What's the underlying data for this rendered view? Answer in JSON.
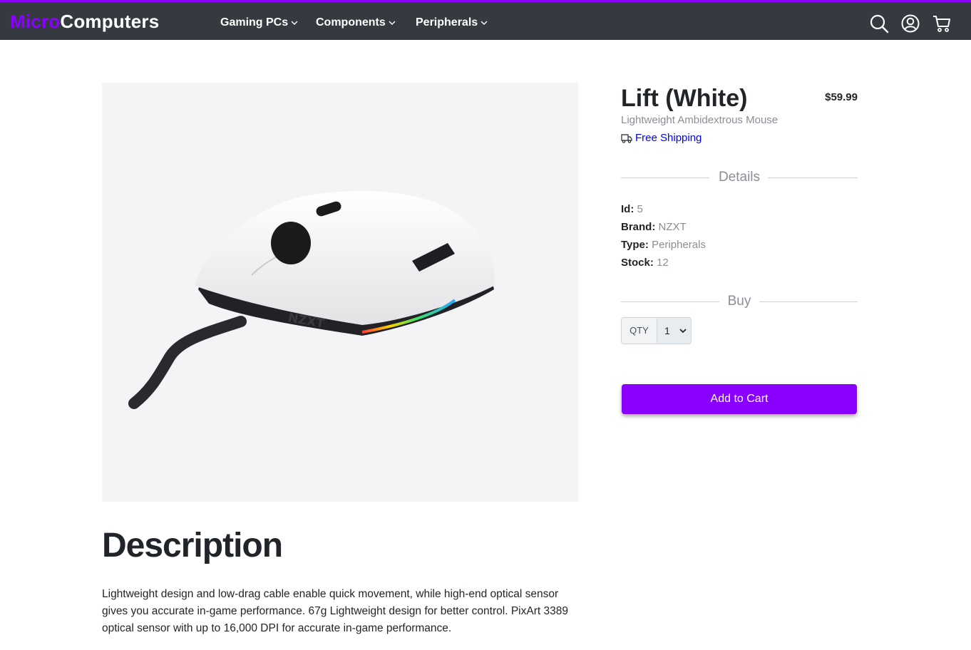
{
  "brand": {
    "part1": "Micro",
    "part2": "Computers"
  },
  "nav": {
    "items": [
      {
        "label": "Gaming PCs"
      },
      {
        "label": "Components"
      },
      {
        "label": "Peripherals"
      }
    ],
    "icons": [
      "search-icon",
      "user-account-icon",
      "shopping-cart-icon"
    ]
  },
  "product": {
    "title": "Lift (White)",
    "price": "$59.99",
    "subtitle": "Lightweight Ambidextrous Mouse",
    "shipping": "Free Shipping",
    "image_brand_text": "NZXT"
  },
  "details": {
    "heading": "Details",
    "rows": [
      {
        "key": "Id:",
        "value": "5"
      },
      {
        "key": "Brand:",
        "value": "NZXT"
      },
      {
        "key": "Type:",
        "value": "Peripherals"
      },
      {
        "key": "Stock:",
        "value": "12"
      }
    ]
  },
  "buy": {
    "heading": "Buy",
    "qty_label": "QTY",
    "qty_value": "1",
    "add_to_cart": "Add to Cart"
  },
  "description": {
    "title": "Description",
    "body": "Lightweight design and low-drag cable enable quick movement, while high-end optical sensor gives you accurate in-game performance. 67g Lightweight design for better control. PixArt 3389 optical sensor with up to 16,000 DPI for accurate in-game performance."
  },
  "colors": {
    "accent": "#8a00ff",
    "navbar_bg": "#343a40",
    "link": "#0000ee",
    "muted": "#8a8f96"
  }
}
